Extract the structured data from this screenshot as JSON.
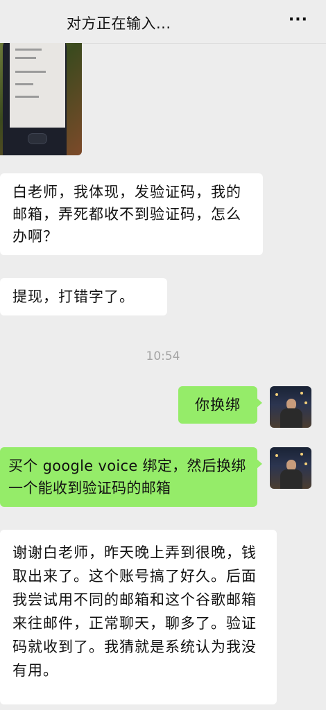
{
  "header": {
    "title": "对方正在输入...",
    "more_icon": "···"
  },
  "messages": [
    {
      "side": "left",
      "text": "白老师，我体现，发验证码，我的邮箱，弄死都收不到验证码，怎么办啊？"
    },
    {
      "side": "left",
      "text": "提现，打错字了。"
    },
    {
      "side": "right",
      "text": "你换绑"
    },
    {
      "side": "right",
      "text": "买个 google voice 绑定，然后换绑一个能收到验证码的邮箱"
    },
    {
      "side": "left",
      "text": "谢谢白老师，昨天晚上弄到很晚，钱取出来了。这个账号搞了好久。后面我尝试用不同的邮箱和这个谷歌邮箱来往邮件，正常聊天，聊多了。验证码就收到了。我猜就是系统认为我没有用。"
    }
  ],
  "timestamp": "10:54",
  "colors": {
    "background": "#ededed",
    "my_bubble": "#95ec69",
    "their_bubble": "#ffffff"
  }
}
